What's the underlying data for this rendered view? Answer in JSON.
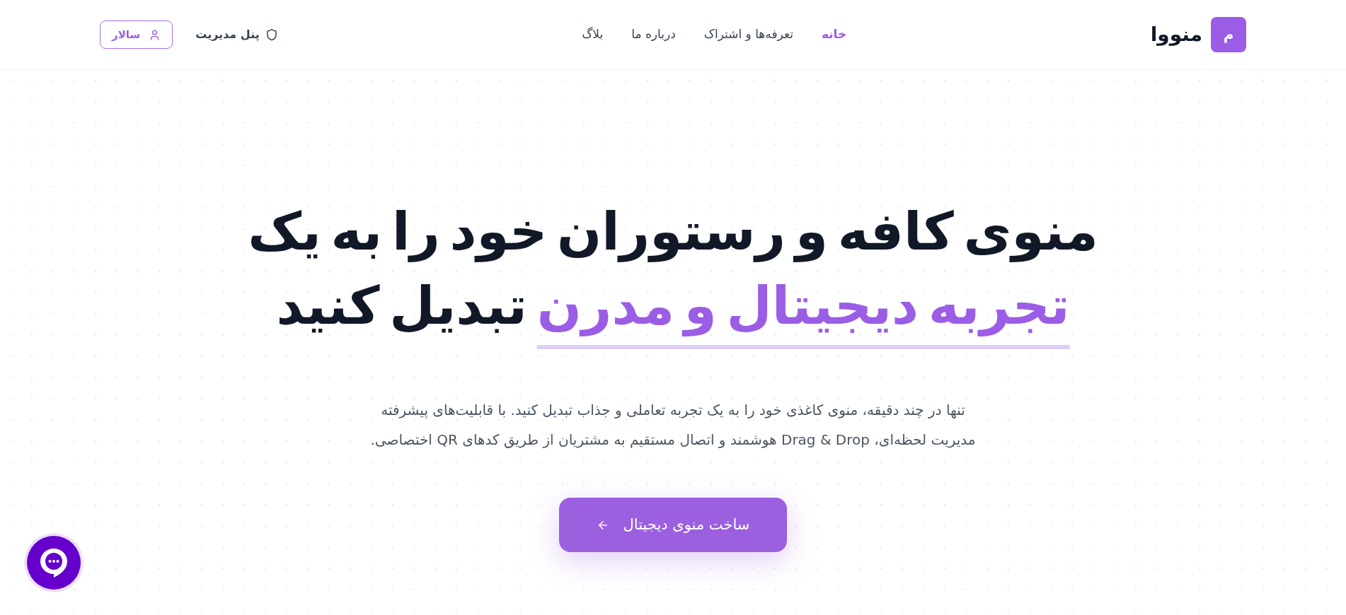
{
  "brand": {
    "logo_letter": "م",
    "name": "منووا"
  },
  "nav": [
    {
      "label": "خانه",
      "selected": true
    },
    {
      "label": "تعرفه‌ها و اشتراک",
      "selected": false
    },
    {
      "label": "درباره ما",
      "selected": false
    },
    {
      "label": "بلاگ",
      "selected": false
    }
  ],
  "actions": {
    "admin_panel": "پنل مدیریت",
    "user": "سالار"
  },
  "hero": {
    "heading": {
      "before": "منوی کافه و رستوران خود را به یک",
      "highlight": "تجربه دیجیتال و مدرن",
      "after": "تبدیل کنید"
    },
    "description": "تنها در چند دقیقه، منوی کاغذی خود را به یک تجربه تعاملی و جذاب تبدیل کنید. با قابلیت‌های پیشرفته مدیریت لحظه‌ای، Drag & Drop هوشمند و اتصال مستقیم به مشتریان از طریق کدهای QR اختصاصی.",
    "cta": "ساخت منوی دیجیتال"
  }
}
